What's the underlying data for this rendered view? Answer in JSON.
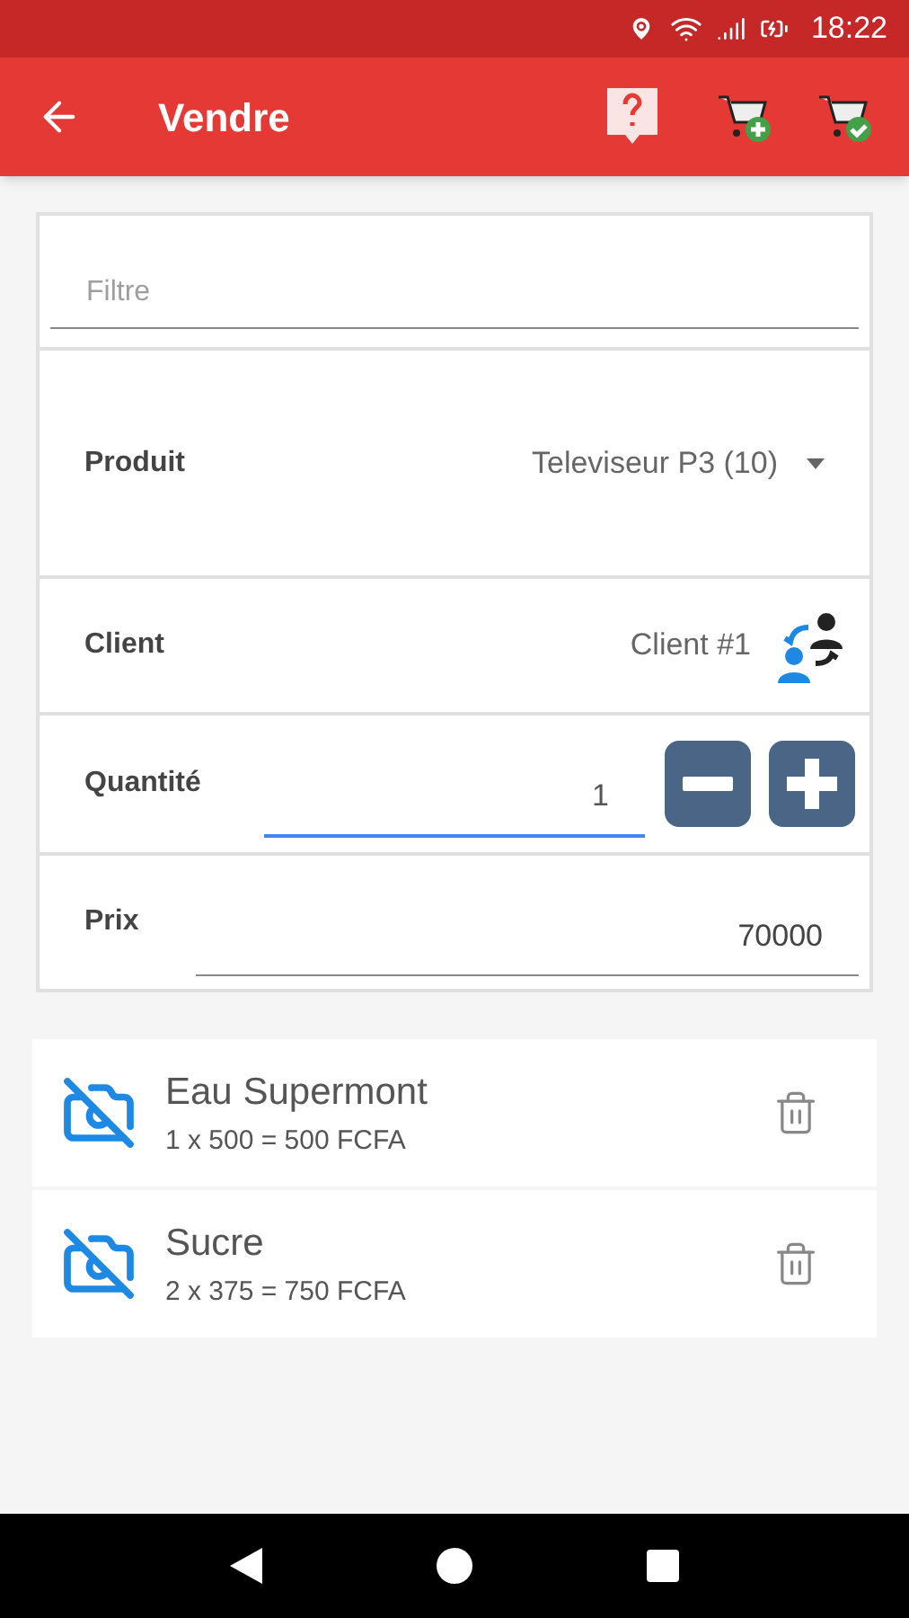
{
  "status_bar": {
    "time": "18:22"
  },
  "app_bar": {
    "title": "Vendre"
  },
  "form": {
    "filter": {
      "placeholder": "Filtre"
    },
    "product": {
      "label": "Produit",
      "value": "Televiseur P3 (10)"
    },
    "client": {
      "label": "Client",
      "value": "Client #1"
    },
    "quantity": {
      "label": "Quantité",
      "value": "1",
      "focused": true
    },
    "price": {
      "label": "Prix",
      "value": "70000"
    }
  },
  "items": [
    {
      "name": "Eau Supermont",
      "detail": "1 x 500 = 500 FCFA"
    },
    {
      "name": "Sucre",
      "detail": "2 x 375 = 750 FCFA"
    }
  ]
}
